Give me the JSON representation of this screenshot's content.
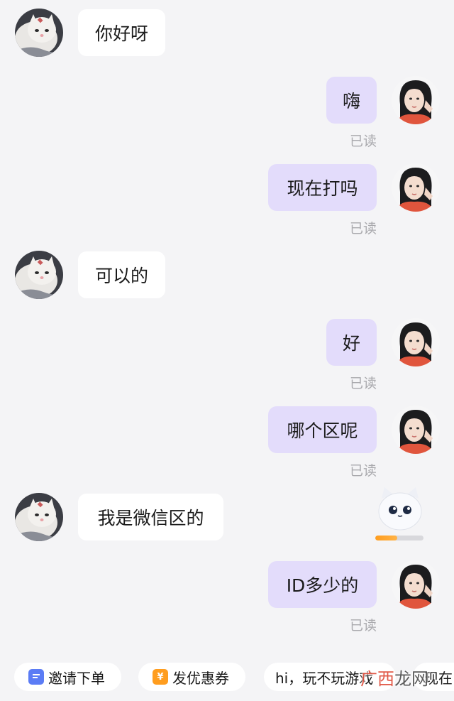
{
  "messages": [
    {
      "side": "in",
      "text": "你好呀"
    },
    {
      "side": "out",
      "text": "嗨",
      "status": "已读"
    },
    {
      "side": "out",
      "text": "现在打吗",
      "status": "已读"
    },
    {
      "side": "in",
      "text": "可以的"
    },
    {
      "side": "out",
      "text": "好",
      "status": "已读"
    },
    {
      "side": "out",
      "text": "哪个区呢",
      "status": "已读"
    },
    {
      "side": "in",
      "text": "我是微信区的"
    },
    {
      "side": "out",
      "text": "ID多少的",
      "status": "已读"
    }
  ],
  "mascot": {
    "icon": "cat-mascot-icon",
    "progress": 0.45
  },
  "quick_replies": [
    {
      "icon": "invite-order-icon",
      "icon_color": "#5b7cf5",
      "label": "邀请下单"
    },
    {
      "icon": "coupon-icon",
      "icon_color": "#ff9d1e",
      "label": "发优惠券"
    },
    {
      "icon": "",
      "icon_color": "",
      "label": "hi，玩不玩游戏"
    },
    {
      "icon": "",
      "icon_color": "",
      "label": "现在"
    }
  ],
  "watermark": {
    "part1": "广西",
    "part2": "龙网"
  },
  "colors": {
    "background": "#f4f4f6",
    "incoming_bubble": "#ffffff",
    "outgoing_bubble": "#e3dcfb",
    "read_status": "#a9a9ad"
  }
}
